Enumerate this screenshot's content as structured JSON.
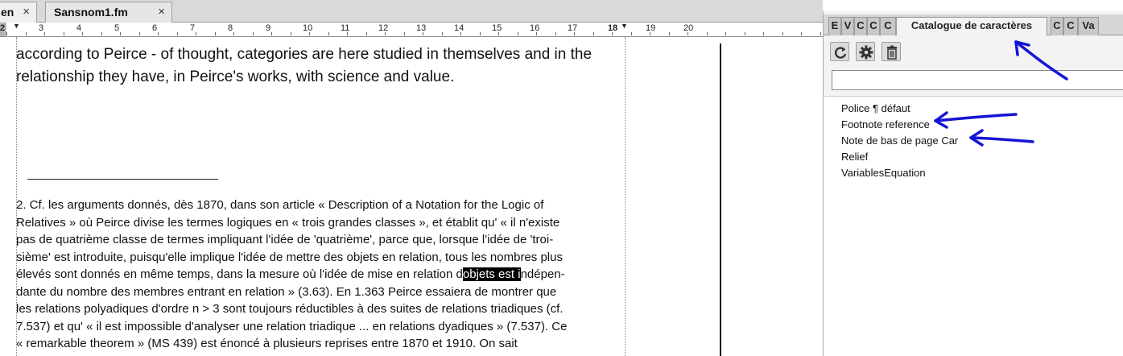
{
  "document_tabs": [
    {
      "label": "en",
      "close": "×"
    },
    {
      "label": "Sansnom1.fm",
      "close": "×"
    }
  ],
  "ruler": {
    "numbers": [
      "2",
      "3",
      "4",
      "5",
      "6",
      "7",
      "8",
      "9",
      "10",
      "11",
      "12",
      "13",
      "14",
      "15",
      "16",
      "17",
      "18",
      "19",
      "20"
    ]
  },
  "document": {
    "body_lines": [
      "according to Peirce - of thought, categories are here studied in themselves and in the",
      "relationship they have, in Peirce's works, with science and value."
    ],
    "footnote": {
      "lines": [
        "2. Cf. les arguments donnés, dès 1870, dans son article « Description of a Notation for the Logic of",
        "Relatives » où Peirce divise les termes logiques en « trois grandes classes », et établit qu' « il n'existe",
        "pas de quatrième classe de termes impliquant l'idée de 'quatrième', parce que, lorsque l'idée de 'troi-",
        "sième' est introduite, puisqu'elle implique l'idée de mettre des objets en relation, tous les nombres plus"
      ],
      "line5_before": "élevés sont donnés en même temps, dans la mesure où l'idée de mise en relation d",
      "line5_selected": "objets est i",
      "line5_after": "ndépen-",
      "lines_after": [
        "dante du nombre des membres entrant en relation » (3.63). En 1.363 Peirce essaiera de montrer que",
        "les relations polyadiques d'ordre n > 3 sont toujours réductibles à des suites de relations triadiques (cf.",
        "7.537) et qu' « il est impossible d'analyser une relation triadique ... en relations dyadiques » (7.537). Ce",
        "« remarkable theorem » (MS 439) est énoncé à plusieurs reprises entre 1870 et 1910. On sait"
      ]
    }
  },
  "panel": {
    "tabs": [
      "E",
      "V",
      "C",
      "C",
      "C",
      "Catalogue de caractères",
      "C",
      "C",
      "Va"
    ],
    "active_tab": "Catalogue de caractères",
    "toolbar": {
      "buttons": [
        "refresh-icon",
        "gear-icon",
        "delete-icon"
      ]
    },
    "search": {
      "value": "",
      "placeholder": ""
    },
    "items": [
      "Police ¶ défaut",
      "Footnote reference",
      "Note de bas de page Car",
      "Relief",
      "VariablesEquation"
    ]
  },
  "colors": {
    "annotation_arrow": "#1515d6",
    "selection": "#000000"
  }
}
